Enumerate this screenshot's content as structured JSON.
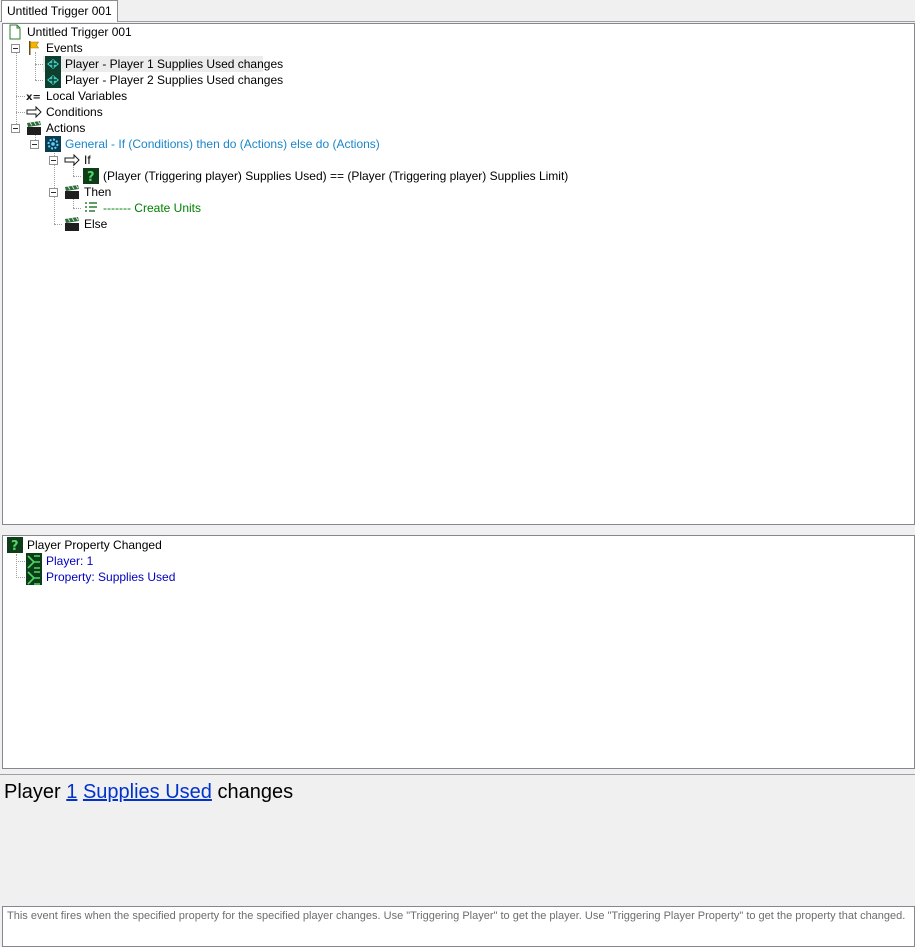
{
  "tab": {
    "label": "Untitled Trigger 001"
  },
  "tree": {
    "root": "Untitled Trigger 001",
    "events": "Events",
    "event1": "Player - Player 1 Supplies Used changes",
    "event2": "Player - Player 2 Supplies Used changes",
    "local_variables": "Local Variables",
    "conditions": "Conditions",
    "actions": "Actions",
    "general_if": "General - If (Conditions) then do (Actions) else do (Actions)",
    "if": "If",
    "condition": "(Player (Triggering player) Supplies Used) == (Player (Triggering player) Supplies Limit)",
    "then": "Then",
    "comment": "------- Create Units",
    "else": "Else"
  },
  "details": {
    "title": "Player Property Changed",
    "param1": "Player: 1",
    "param2": "Property: Supplies Used"
  },
  "sentence": {
    "prefix": "Player",
    "link1": "1",
    "link2": "Supplies Used",
    "suffix": "changes"
  },
  "description": "This event fires when the specified property for the specified player changes.  Use \"Triggering Player\" to get the player.  Use \"Triggering Player Property\" to get the property that changed.",
  "colors": {
    "function_blue": "#1a86c9",
    "comment_green": "#008000",
    "param_navy": "#0000c0",
    "link_blue": "#0033cc"
  },
  "icons": [
    "document-icon",
    "events-flag-icon",
    "player-event-icon",
    "local-variables-icon",
    "conditions-arrow-icon",
    "actions-clapper-icon",
    "general-gear-icon",
    "condition-question-icon",
    "comment-lines-icon",
    "parameter-icon"
  ]
}
